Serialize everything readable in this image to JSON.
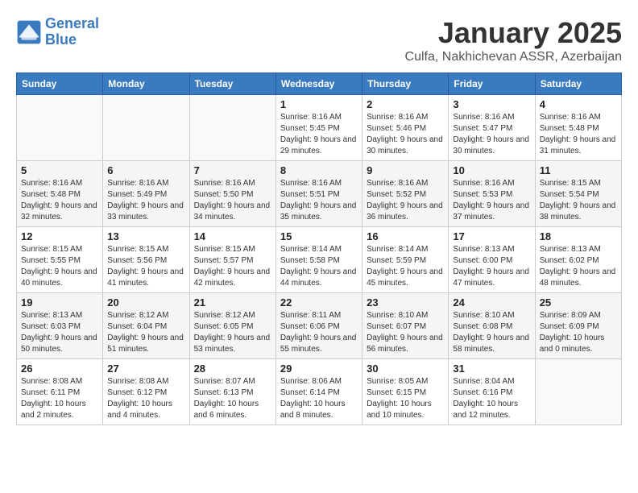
{
  "logo": {
    "line1": "General",
    "line2": "Blue"
  },
  "title": "January 2025",
  "subtitle": "Culfa, Nakhichevan ASSR, Azerbaijan",
  "headers": [
    "Sunday",
    "Monday",
    "Tuesday",
    "Wednesday",
    "Thursday",
    "Friday",
    "Saturday"
  ],
  "weeks": [
    [
      {
        "day": "",
        "info": ""
      },
      {
        "day": "",
        "info": ""
      },
      {
        "day": "",
        "info": ""
      },
      {
        "day": "1",
        "info": "Sunrise: 8:16 AM\nSunset: 5:45 PM\nDaylight: 9 hours and 29 minutes."
      },
      {
        "day": "2",
        "info": "Sunrise: 8:16 AM\nSunset: 5:46 PM\nDaylight: 9 hours and 30 minutes."
      },
      {
        "day": "3",
        "info": "Sunrise: 8:16 AM\nSunset: 5:47 PM\nDaylight: 9 hours and 30 minutes."
      },
      {
        "day": "4",
        "info": "Sunrise: 8:16 AM\nSunset: 5:48 PM\nDaylight: 9 hours and 31 minutes."
      }
    ],
    [
      {
        "day": "5",
        "info": "Sunrise: 8:16 AM\nSunset: 5:48 PM\nDaylight: 9 hours and 32 minutes."
      },
      {
        "day": "6",
        "info": "Sunrise: 8:16 AM\nSunset: 5:49 PM\nDaylight: 9 hours and 33 minutes."
      },
      {
        "day": "7",
        "info": "Sunrise: 8:16 AM\nSunset: 5:50 PM\nDaylight: 9 hours and 34 minutes."
      },
      {
        "day": "8",
        "info": "Sunrise: 8:16 AM\nSunset: 5:51 PM\nDaylight: 9 hours and 35 minutes."
      },
      {
        "day": "9",
        "info": "Sunrise: 8:16 AM\nSunset: 5:52 PM\nDaylight: 9 hours and 36 minutes."
      },
      {
        "day": "10",
        "info": "Sunrise: 8:16 AM\nSunset: 5:53 PM\nDaylight: 9 hours and 37 minutes."
      },
      {
        "day": "11",
        "info": "Sunrise: 8:15 AM\nSunset: 5:54 PM\nDaylight: 9 hours and 38 minutes."
      }
    ],
    [
      {
        "day": "12",
        "info": "Sunrise: 8:15 AM\nSunset: 5:55 PM\nDaylight: 9 hours and 40 minutes."
      },
      {
        "day": "13",
        "info": "Sunrise: 8:15 AM\nSunset: 5:56 PM\nDaylight: 9 hours and 41 minutes."
      },
      {
        "day": "14",
        "info": "Sunrise: 8:15 AM\nSunset: 5:57 PM\nDaylight: 9 hours and 42 minutes."
      },
      {
        "day": "15",
        "info": "Sunrise: 8:14 AM\nSunset: 5:58 PM\nDaylight: 9 hours and 44 minutes."
      },
      {
        "day": "16",
        "info": "Sunrise: 8:14 AM\nSunset: 5:59 PM\nDaylight: 9 hours and 45 minutes."
      },
      {
        "day": "17",
        "info": "Sunrise: 8:13 AM\nSunset: 6:00 PM\nDaylight: 9 hours and 47 minutes."
      },
      {
        "day": "18",
        "info": "Sunrise: 8:13 AM\nSunset: 6:02 PM\nDaylight: 9 hours and 48 minutes."
      }
    ],
    [
      {
        "day": "19",
        "info": "Sunrise: 8:13 AM\nSunset: 6:03 PM\nDaylight: 9 hours and 50 minutes."
      },
      {
        "day": "20",
        "info": "Sunrise: 8:12 AM\nSunset: 6:04 PM\nDaylight: 9 hours and 51 minutes."
      },
      {
        "day": "21",
        "info": "Sunrise: 8:12 AM\nSunset: 6:05 PM\nDaylight: 9 hours and 53 minutes."
      },
      {
        "day": "22",
        "info": "Sunrise: 8:11 AM\nSunset: 6:06 PM\nDaylight: 9 hours and 55 minutes."
      },
      {
        "day": "23",
        "info": "Sunrise: 8:10 AM\nSunset: 6:07 PM\nDaylight: 9 hours and 56 minutes."
      },
      {
        "day": "24",
        "info": "Sunrise: 8:10 AM\nSunset: 6:08 PM\nDaylight: 9 hours and 58 minutes."
      },
      {
        "day": "25",
        "info": "Sunrise: 8:09 AM\nSunset: 6:09 PM\nDaylight: 10 hours and 0 minutes."
      }
    ],
    [
      {
        "day": "26",
        "info": "Sunrise: 8:08 AM\nSunset: 6:11 PM\nDaylight: 10 hours and 2 minutes."
      },
      {
        "day": "27",
        "info": "Sunrise: 8:08 AM\nSunset: 6:12 PM\nDaylight: 10 hours and 4 minutes."
      },
      {
        "day": "28",
        "info": "Sunrise: 8:07 AM\nSunset: 6:13 PM\nDaylight: 10 hours and 6 minutes."
      },
      {
        "day": "29",
        "info": "Sunrise: 8:06 AM\nSunset: 6:14 PM\nDaylight: 10 hours and 8 minutes."
      },
      {
        "day": "30",
        "info": "Sunrise: 8:05 AM\nSunset: 6:15 PM\nDaylight: 10 hours and 10 minutes."
      },
      {
        "day": "31",
        "info": "Sunrise: 8:04 AM\nSunset: 6:16 PM\nDaylight: 10 hours and 12 minutes."
      },
      {
        "day": "",
        "info": ""
      }
    ]
  ]
}
